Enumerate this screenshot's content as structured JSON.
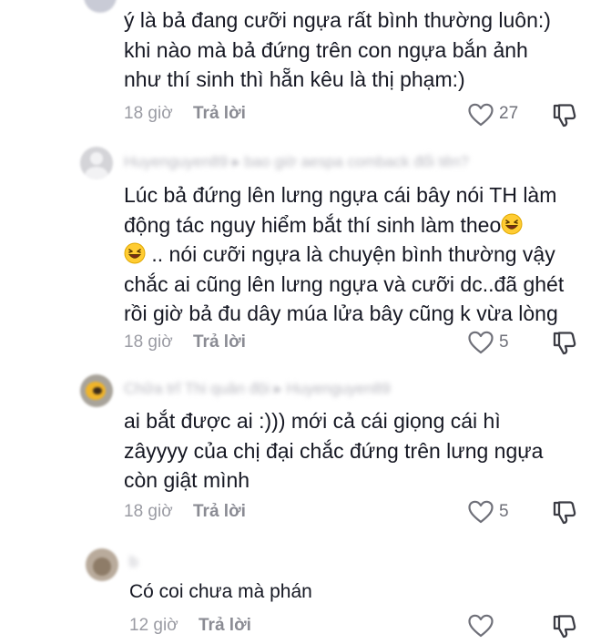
{
  "comments": [
    {
      "text": "ý là bả đang cưỡi ngựa rất bình thường luôn:)\nkhi nào mà bả đứng trên con ngựa bắn ảnh\nnhư thí sinh thì hẵn kêu là thị phạm:)",
      "time": "18 giờ",
      "reply": "Trả lời",
      "likes": "27"
    },
    {
      "username": "Huyenguyen89 ▸ bao giờ aespa comback đổi tên?",
      "text_a": "Lúc bả đứng lên lưng ngựa cái bây nói TH làm\nđộng tác nguy hiểm bắt thí sinh làm theo",
      "text_b": " .. nói cưỡi ngựa là chuyện bình thường vậy\nchắc ai cũng lên lưng ngựa và cưỡi dc..đã ghét\nrồi giờ bả đu dây múa lửa bây cũng k vừa lòng",
      "time": "18 giờ",
      "reply": "Trả lời",
      "likes": "5"
    },
    {
      "username": "Chữa trĩ Thi quân đội ▸ Huyenguyen89",
      "text": "ai bắt được ai :))) mới cả cái giọng cái hì\nzâyyyy của chị đại chắc đứng trên lưng ngựa\ncòn giật mình",
      "time": "18 giờ",
      "reply": "Trả lời",
      "likes": "5"
    },
    {
      "username": "b",
      "text": "Có coi chưa mà phán",
      "time": "12 giờ",
      "reply": "Trả lời",
      "likes": ""
    }
  ],
  "colors": {
    "text": "#161823",
    "meta": "#9a9ba3",
    "icon": "#6f7079"
  },
  "icons": [
    "heart-outline-icon",
    "thumbs-down-icon",
    "laughing-emoji-icon"
  ]
}
